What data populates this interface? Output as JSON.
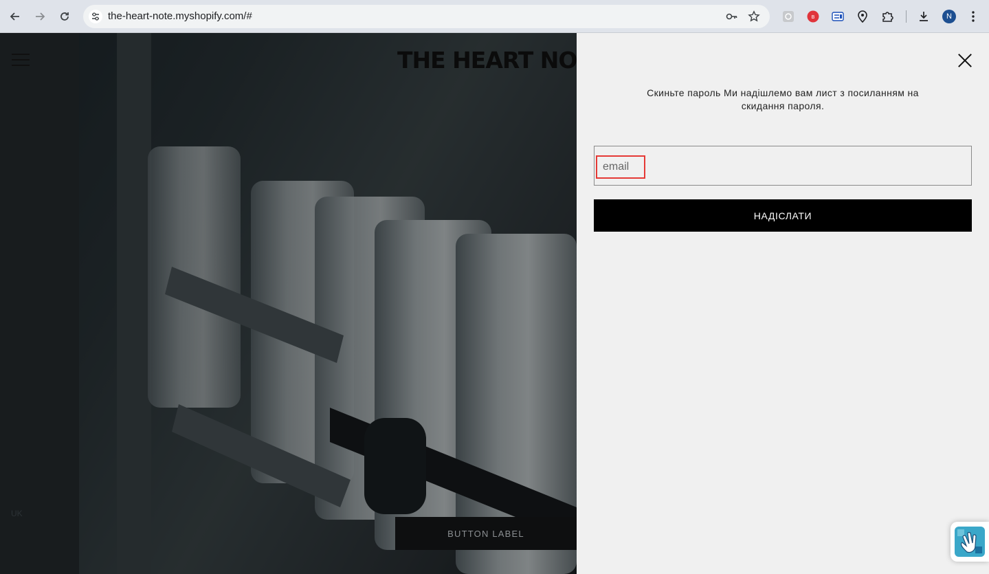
{
  "browser": {
    "url": "the-heart-note.myshopify.com/#",
    "profile_initial": "N",
    "icons": [
      "back-icon",
      "forward-icon",
      "reload-icon",
      "site-settings-icon",
      "key-icon",
      "bookmark-star-icon",
      "extension-icon",
      "extension-red-icon",
      "extension-blue-icon",
      "location-pin-icon",
      "puzzle-icon",
      "download-icon",
      "more-icon"
    ]
  },
  "header": {
    "logo": "THE HEART NOT"
  },
  "hero": {
    "locale_label": "UK",
    "button_label": "BUTTON LABEL"
  },
  "drawer": {
    "notice": "Скиньте пароль Ми надішлемо вам лист з посиланням на скидання пароля.",
    "email_placeholder": "email",
    "submit_label": "НАДІСЛАТИ"
  },
  "colors": {
    "drawer_bg": "#f0f0f0",
    "submit_bg": "#000000",
    "highlight": "#e53935"
  }
}
